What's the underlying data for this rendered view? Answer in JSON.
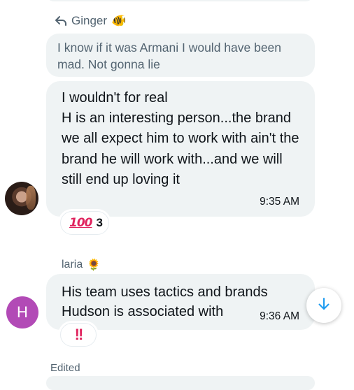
{
  "reply": {
    "label": "Ginger",
    "emoji": "🐠",
    "quoted_text": "I know if it was Armani I would have been mad. Not gonna lie"
  },
  "message1": {
    "text": "I wouldn't for real\nH is an interesting person...the brand we all expect him to work with ain't the brand he will work with...and we will still end up loving it",
    "time": "9:35 AM",
    "reaction": {
      "emoji": "💯",
      "label": "100",
      "count": "3"
    }
  },
  "message2": {
    "sender": "laria",
    "sender_emoji": "🌻",
    "avatar_letter": "H",
    "text": "His team uses tactics and brands Hudson is associated with",
    "time": "9:36 AM",
    "reaction": {
      "emoji": "‼️",
      "label": "!!"
    }
  },
  "footer": {
    "edited": "Edited"
  },
  "colors": {
    "bubble": "#eff3f4",
    "secondary_text": "#536471",
    "avatar_letter_bg": "#b24ab6",
    "accent": "#1d9bf0",
    "reaction_red": "#e0245e"
  },
  "icons": {
    "reply": "reply-arrow-icon",
    "scroll": "arrow-down-icon"
  }
}
